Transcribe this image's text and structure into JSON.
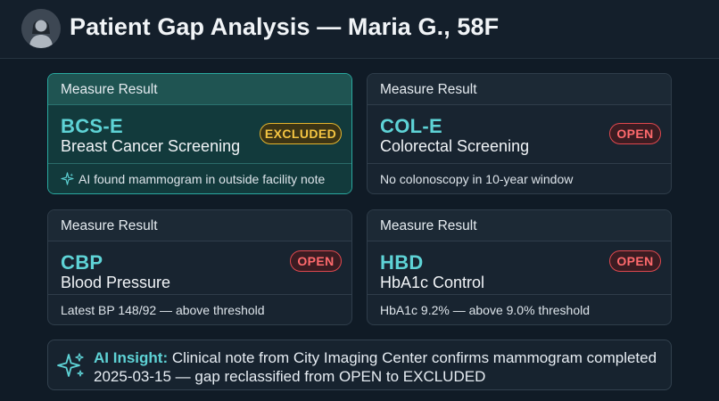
{
  "header": {
    "title": "Patient Gap Analysis — Maria G., 58F",
    "avatar_icon": "user-avatar-icon"
  },
  "measures": [
    {
      "header_label": "Measure Result",
      "code": "BCS-E",
      "name": "Breast Cancer Screening",
      "status": "EXCLUDED",
      "note": "AI found mammogram in outside facility note",
      "note_icon": "sparkle-icon",
      "highlighted": true
    },
    {
      "header_label": "Measure Result",
      "code": "COL-E",
      "name": "Colorectal Screening",
      "status": "OPEN",
      "note": "No colonoscopy in 10-year window",
      "highlighted": false
    },
    {
      "header_label": "Measure Result",
      "code": "CBP",
      "name": "Blood Pressure",
      "status": "OPEN",
      "note": "Latest BP 148/92 — above threshold",
      "highlighted": false
    },
    {
      "header_label": "Measure Result",
      "code": "HBD",
      "name": "HbA1c Control",
      "status": "OPEN",
      "note": "HbA1c 9.2% — above 9.0% threshold",
      "highlighted": false
    }
  ],
  "insight": {
    "label": "AI Insight:",
    "text": " Clinical note from City Imaging Center confirms mammogram completed 2025-03-15 — gap reclassified from OPEN to EXCLUDED",
    "icon": "sparkle-icon"
  },
  "colors": {
    "accent_teal": "#5ed3d6",
    "open_red": "#e0484e",
    "excluded_amber": "#e5b52e",
    "background": "#101b26"
  }
}
